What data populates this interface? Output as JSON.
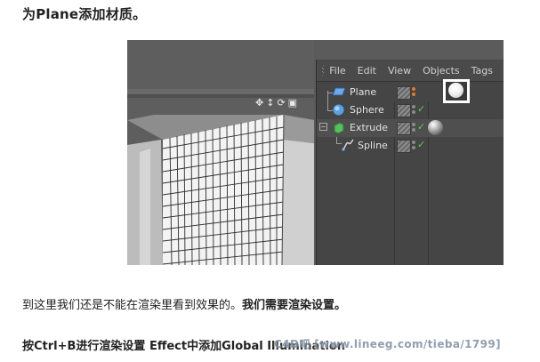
{
  "heading": "为Plane添加材质。",
  "viewport": {
    "tool_icons": [
      "move-icon",
      "updown-icon",
      "rotate-icon",
      "maximize-icon"
    ],
    "tool_glyphs": [
      "✥",
      "↕",
      "⟳",
      "▣"
    ]
  },
  "object_manager": {
    "menu": [
      "File",
      "Edit",
      "View",
      "Objects",
      "Tags"
    ],
    "objects": [
      {
        "name": "Plane",
        "icon": "plane-icon",
        "has_material": true,
        "material_selected": true
      },
      {
        "name": "Sphere",
        "icon": "sphere-icon",
        "has_material": false
      },
      {
        "name": "Extrude",
        "icon": "extrude-icon",
        "has_material": true,
        "material_selected": false
      },
      {
        "name": "Spline",
        "icon": "spline-icon",
        "has_material": false
      }
    ]
  },
  "paragraph1": {
    "normal": "到这里我们还是不能在渲染里看到效果的。",
    "bold": "我们需要渲染设置。"
  },
  "paragraph2": "按Ctrl+B进行渲染设置 Effect中添加Global Illumination",
  "watermark": "C4D吧 [www.lineeg.com/tieba/1799]",
  "colors": {
    "ui_dark": "#454545",
    "accent_check": "#57d15a",
    "selection_highlight": "#ffffff"
  }
}
